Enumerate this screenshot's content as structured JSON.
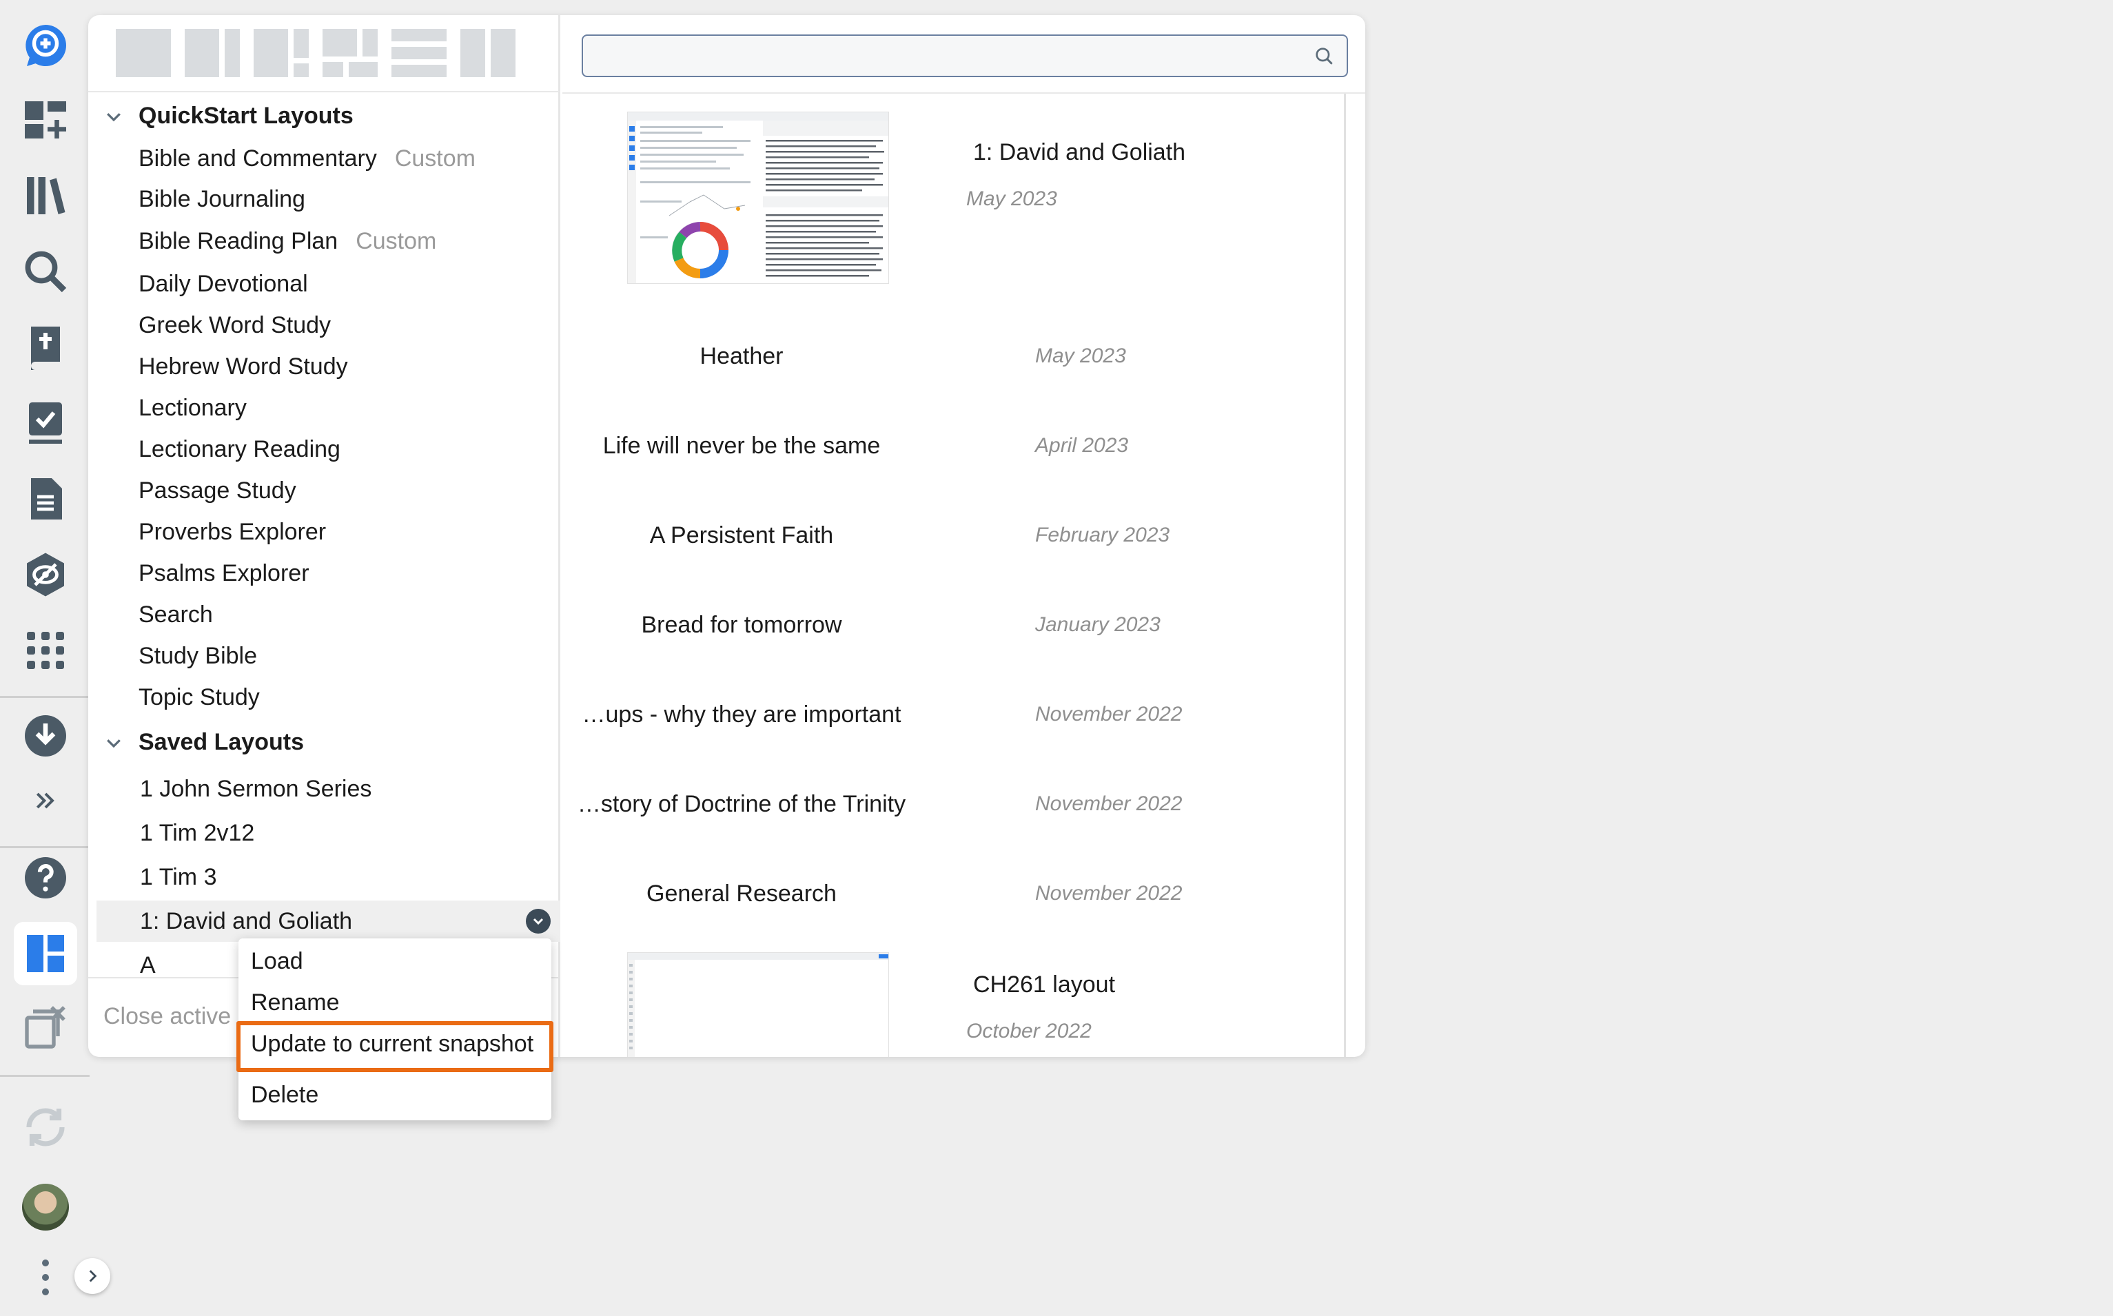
{
  "rail": {
    "icons": [
      "add-search-icon",
      "layouts-add-icon",
      "library-icon",
      "search-icon",
      "bible-icon",
      "checklist-icon",
      "document-icon",
      "eye-shield-icon",
      "apps-grid-icon",
      "download-icon",
      "double-chevron-right-icon",
      "help-icon",
      "layouts-icon",
      "close-panels-icon",
      "sync-icon",
      "avatar",
      "more-vertical-icon",
      "expand-chevron-icon"
    ]
  },
  "left": {
    "groups": [
      {
        "label": "QuickStart Layouts",
        "items": [
          {
            "label": "Bible and Commentary",
            "tag": "Custom"
          },
          {
            "label": "Bible Journaling",
            "tag": ""
          },
          {
            "label": "Bible Reading Plan",
            "tag": "Custom"
          },
          {
            "label": "Daily Devotional",
            "tag": ""
          },
          {
            "label": "Greek Word Study",
            "tag": ""
          },
          {
            "label": "Hebrew Word Study",
            "tag": ""
          },
          {
            "label": "Lectionary",
            "tag": ""
          },
          {
            "label": "Lectionary Reading",
            "tag": ""
          },
          {
            "label": "Passage Study",
            "tag": ""
          },
          {
            "label": "Proverbs Explorer",
            "tag": ""
          },
          {
            "label": "Psalms Explorer",
            "tag": ""
          },
          {
            "label": "Search",
            "tag": ""
          },
          {
            "label": "Study Bible",
            "tag": ""
          },
          {
            "label": "Topic Study",
            "tag": ""
          }
        ]
      },
      {
        "label": "Saved Layouts",
        "items": [
          {
            "label": "1 John Sermon Series"
          },
          {
            "label": "1 Tim 2v12"
          },
          {
            "label": "1 Tim 3"
          },
          {
            "label": "1: David and Goliath"
          },
          {
            "label": "A"
          }
        ]
      }
    ],
    "footer": "Close active l"
  },
  "right": {
    "search": {
      "value": "",
      "placeholder": ""
    },
    "rows": [
      {
        "name": "1: David and Goliath",
        "date": "May 2023",
        "thumb": true
      },
      {
        "name": "Heather",
        "date": "May 2023"
      },
      {
        "name": "Life will never be the same",
        "date": "April 2023"
      },
      {
        "name": "A Persistent Faith",
        "date": "February 2023"
      },
      {
        "name": "Bread for tomorrow",
        "date": "January 2023"
      },
      {
        "name": "…ups - why they are important",
        "date": "November 2022"
      },
      {
        "name": "…story of Doctrine of the Trinity",
        "date": "November 2022"
      },
      {
        "name": "General Research",
        "date": "November 2022"
      },
      {
        "name": "CH261 layout",
        "date": "October 2022",
        "thumb": true
      }
    ],
    "thumb_label": "Heather"
  },
  "context_menu": {
    "items": [
      "Load",
      "Rename",
      "Update to current snapshot",
      "Delete"
    ],
    "highlight_color": "#ea6b14"
  },
  "colors": {
    "accent": "#2b7de9",
    "highlight": "#ea6b14",
    "text_muted": "#9a9a9a"
  }
}
